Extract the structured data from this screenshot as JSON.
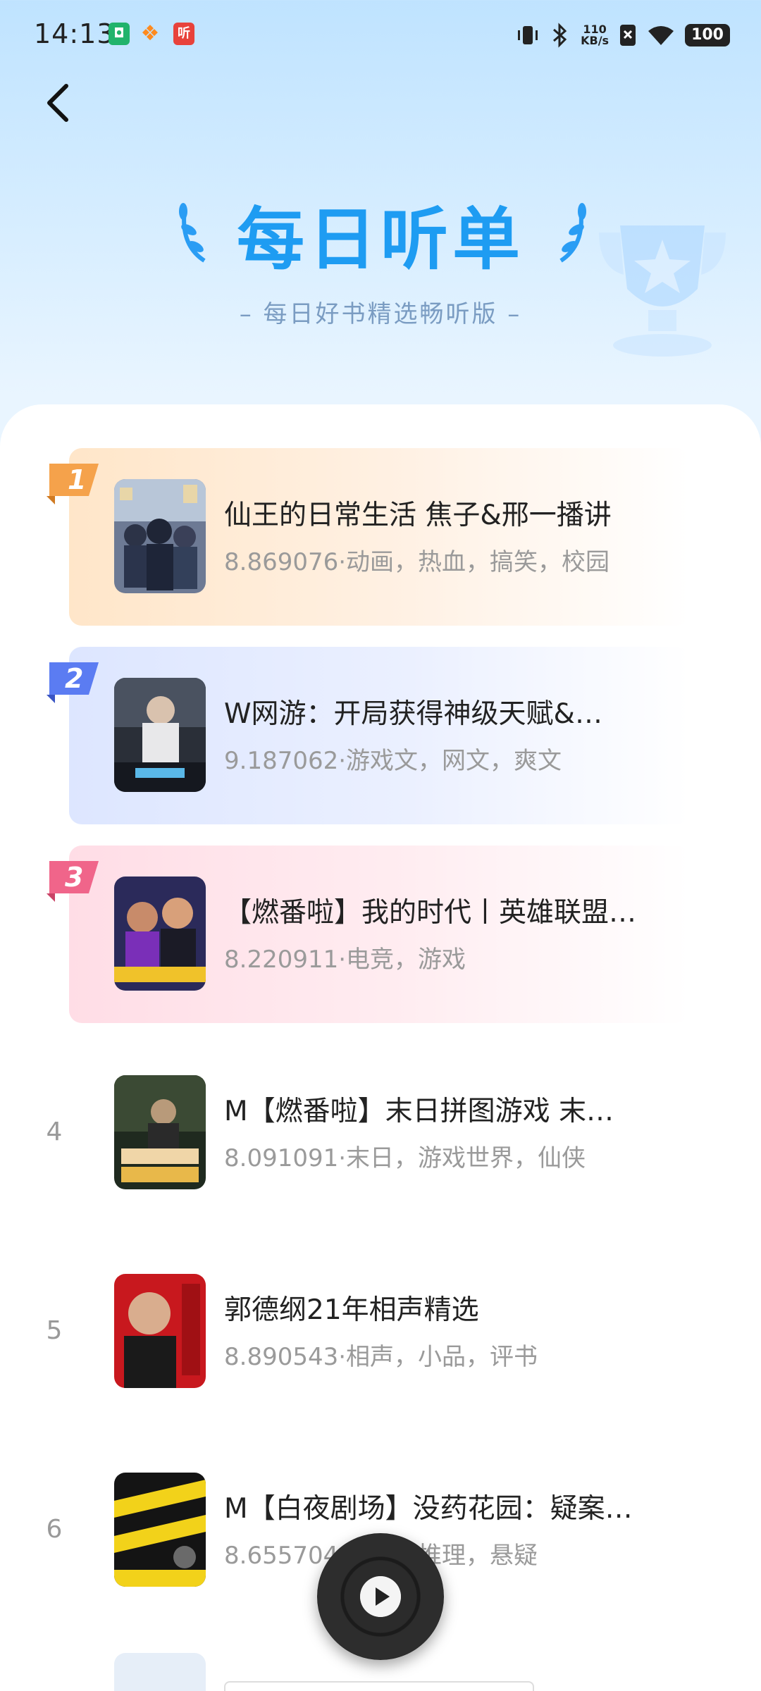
{
  "status_bar": {
    "time": "14:13",
    "net_speed_top": "110",
    "net_speed_bottom": "KB/s",
    "battery": "100"
  },
  "header": {
    "title": "每日听单",
    "subtitle": "– 每日好书精选畅听版 –"
  },
  "colors": {
    "accent": "#1e9cf2",
    "rank1": "#f5a24b",
    "rank2": "#5b7cf2",
    "rank3": "#f0658a"
  },
  "list": [
    {
      "rank": "1",
      "title": "仙王的日常生活  焦子&邢一播讲",
      "meta": "8.869076·动画，热血，搞笑，校园"
    },
    {
      "rank": "2",
      "title": "W网游：开局获得神级天赋&…",
      "meta": "9.187062·游戏文，网文，爽文"
    },
    {
      "rank": "3",
      "title": "【燃番啦】我的时代丨英雄联盟…",
      "meta": "8.220911·电竞，游戏"
    },
    {
      "rank": "4",
      "title": "M【燃番啦】末日拼图游戏  末…",
      "meta": "8.091091·末日，游戏世界，仙侠"
    },
    {
      "rank": "5",
      "title": "郭德纲21年相声精选",
      "meta": "8.890543·相声，小品，评书"
    },
    {
      "rank": "6",
      "title": "M【白夜剧场】没药花园：疑案…",
      "meta": "8.655704·悬疑，推理，悬疑"
    }
  ],
  "icons": {
    "back": "chevron-left-icon",
    "player": "play-icon"
  }
}
